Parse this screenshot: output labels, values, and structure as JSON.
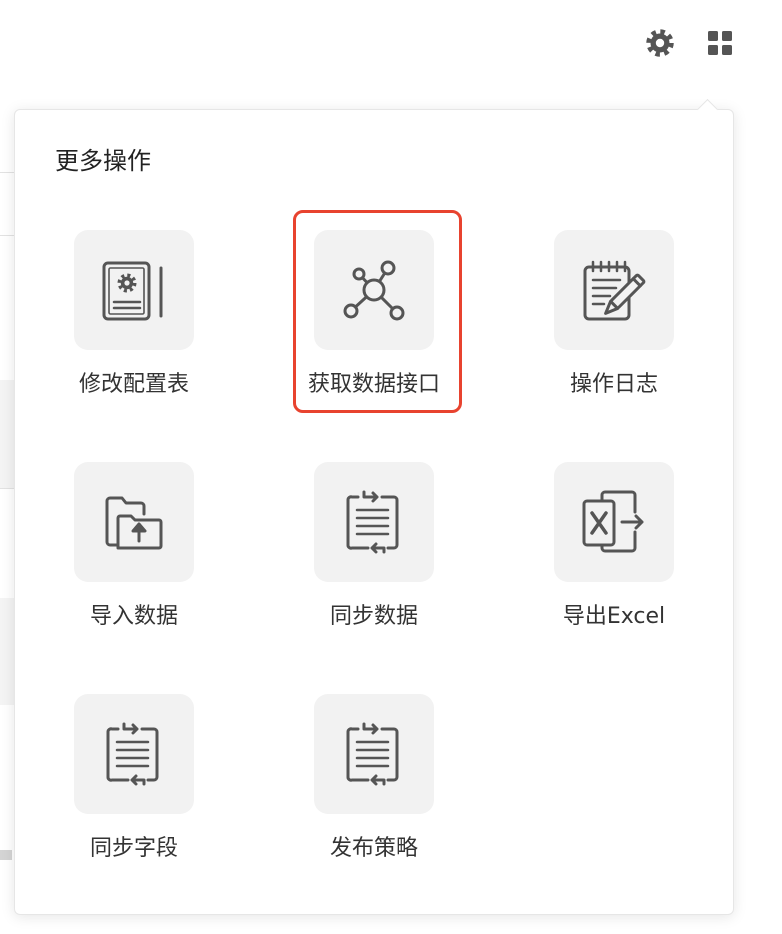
{
  "toolbar": {
    "settings_icon": "gear-icon",
    "apps_icon": "grid-icon"
  },
  "popover": {
    "title": "更多操作",
    "items": [
      {
        "label": "修改配置表",
        "icon": "config-document-icon"
      },
      {
        "label": "获取数据接口",
        "icon": "network-nodes-icon",
        "highlighted": true
      },
      {
        "label": "操作日志",
        "icon": "notepad-pencil-icon"
      },
      {
        "label": "导入数据",
        "icon": "folder-upload-icon"
      },
      {
        "label": "同步数据",
        "icon": "document-sync-icon"
      },
      {
        "label": "导出Excel",
        "icon": "excel-export-icon"
      },
      {
        "label": "同步字段",
        "icon": "document-sync-icon"
      },
      {
        "label": "发布策略",
        "icon": "document-sync-icon"
      }
    ]
  },
  "colors": {
    "highlight": "#e8432f",
    "icon": "#555555",
    "tile": "#f2f2f2",
    "text": "#333333"
  }
}
